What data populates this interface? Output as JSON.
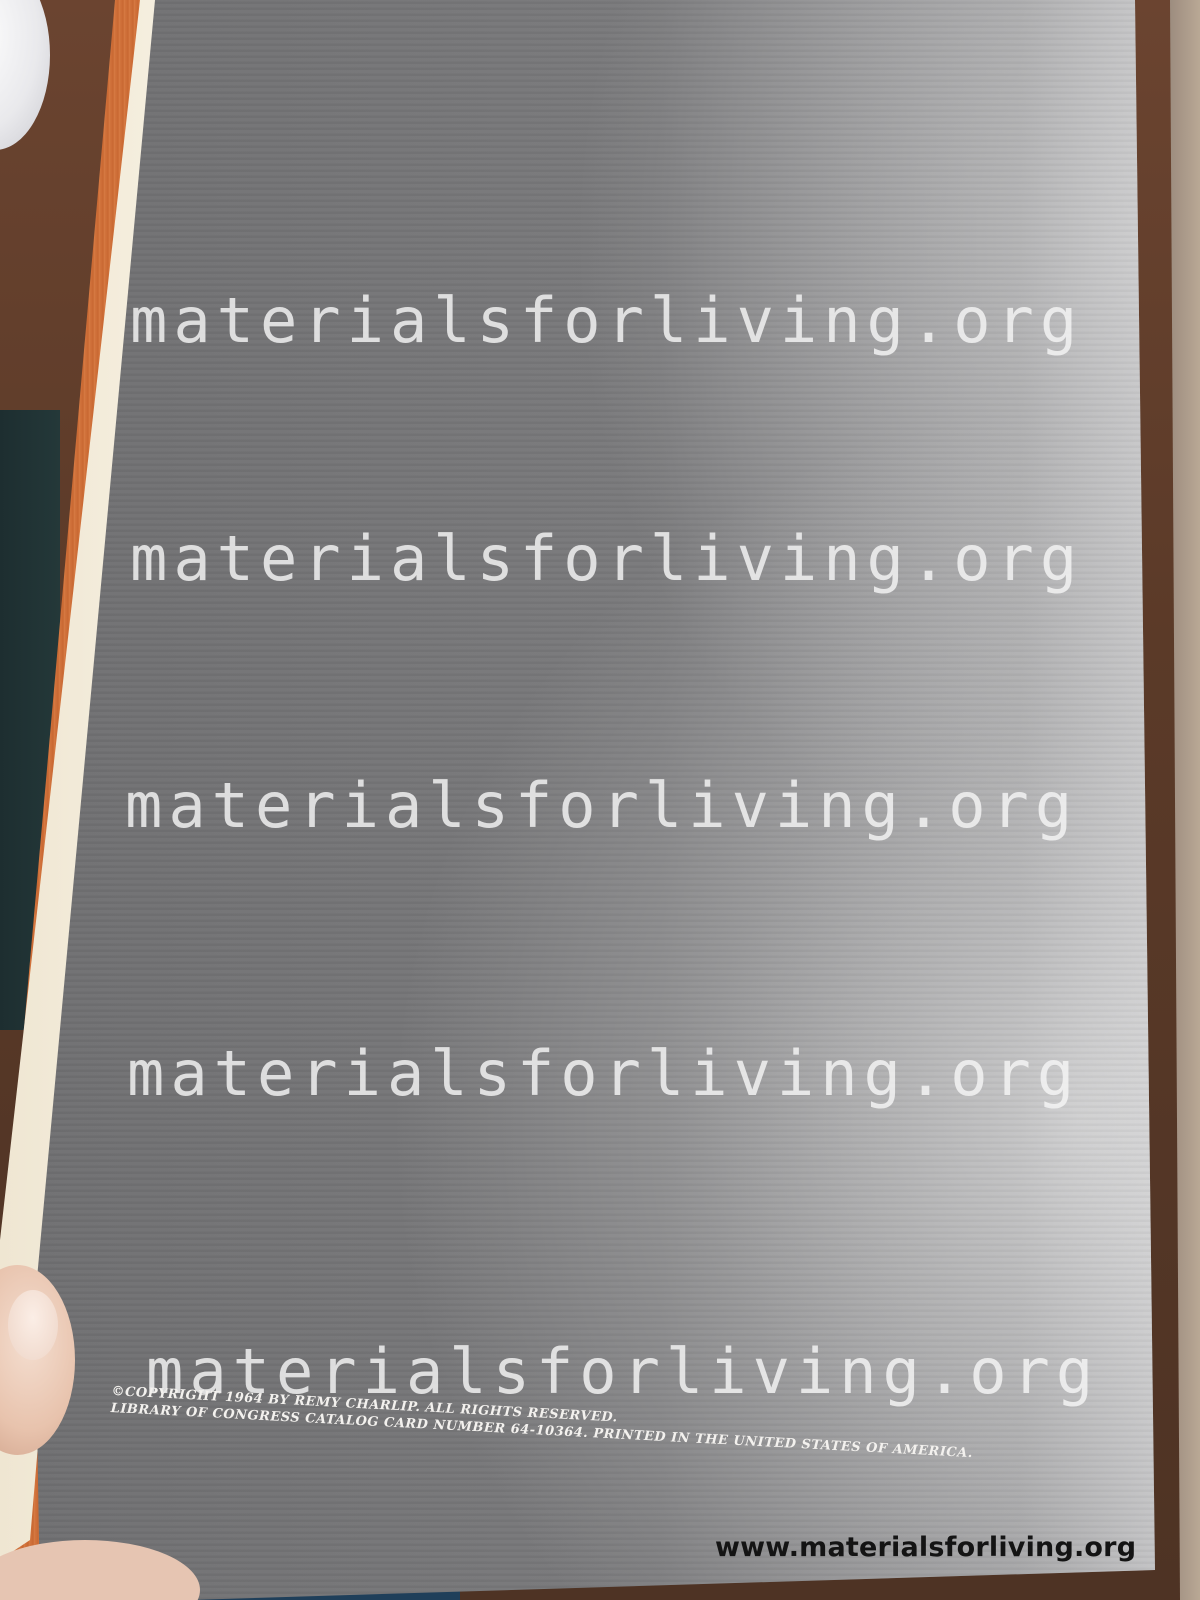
{
  "photo": {
    "watermark_lines": [
      "materialsforliving.org",
      "materialsforliving.org",
      "materialsforliving.org",
      "materialsforliving.org",
      "materialsforliving.org"
    ],
    "copyright_lines": [
      "©COPYRIGHT 1964 BY REMY CHARLIP. ALL RIGHTS RESERVED.",
      "LIBRARY OF CONGRESS CATALOG CARD NUMBER 64-10364. PRINTED IN THE UNITED STATES OF AMERICA."
    ],
    "footer_url": "www.materialsforliving.org"
  }
}
